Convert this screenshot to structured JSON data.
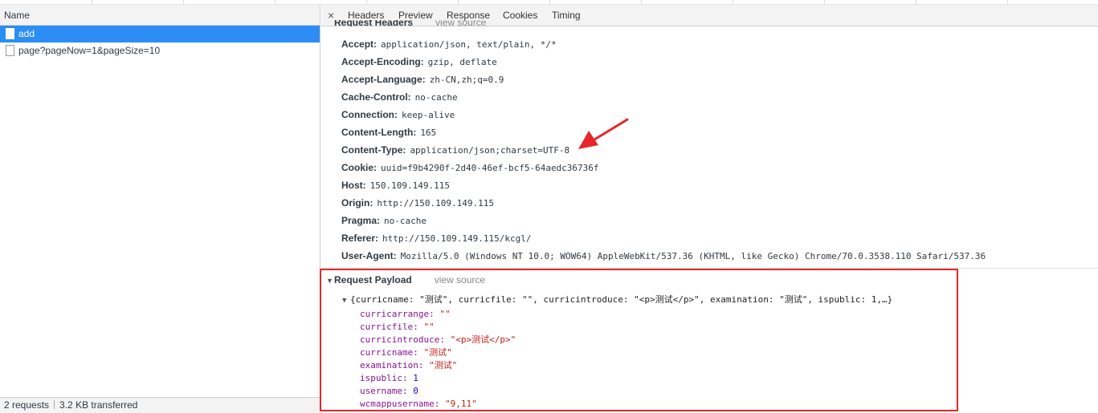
{
  "network": {
    "name_column_label": "Name",
    "requests": [
      {
        "name": "add",
        "selected": true
      },
      {
        "name": "page?pageNow=1&pageSize=10",
        "selected": false
      }
    ],
    "status": {
      "requests": "2 requests",
      "transferred": "3.2 KB transferred"
    }
  },
  "details": {
    "close_symbol": "×",
    "tabs": [
      "Headers",
      "Preview",
      "Response",
      "Cookies",
      "Timing"
    ],
    "request_headers_title": "Request Headers",
    "view_source_label": "view source",
    "headers": [
      {
        "key": "Accept:",
        "value": "application/json, text/plain, */*"
      },
      {
        "key": "Accept-Encoding:",
        "value": "gzip, deflate"
      },
      {
        "key": "Accept-Language:",
        "value": "zh-CN,zh;q=0.9"
      },
      {
        "key": "Cache-Control:",
        "value": "no-cache"
      },
      {
        "key": "Connection:",
        "value": "keep-alive"
      },
      {
        "key": "Content-Length:",
        "value": "165"
      },
      {
        "key": "Content-Type:",
        "value": "application/json;charset=UTF-8"
      },
      {
        "key": "Cookie:",
        "value": "uuid=f9b4290f-2d40-46ef-bcf5-64aedc36736f"
      },
      {
        "key": "Host:",
        "value": "150.109.149.115"
      },
      {
        "key": "Origin:",
        "value": "http://150.109.149.115"
      },
      {
        "key": "Pragma:",
        "value": "no-cache"
      },
      {
        "key": "Referer:",
        "value": "http://150.109.149.115/kcgl/"
      },
      {
        "key": "User-Agent:",
        "value": "Mozilla/5.0 (Windows NT 10.0; WOW64) AppleWebKit/537.36 (KHTML, like Gecko) Chrome/70.0.3538.110 Safari/537.36"
      }
    ],
    "payload": {
      "title": "Request Payload",
      "view_source_label": "view source",
      "summary": "{curricname: \"测试\", curricfile: \"\", curricintroduce: \"<p>测试</p>\", examination: \"测试\", ispublic: 1,…}",
      "fields": [
        {
          "key": "curricarrange:",
          "value": "\"\"",
          "type": "string"
        },
        {
          "key": "curricfile:",
          "value": "\"\"",
          "type": "string"
        },
        {
          "key": "curricintroduce:",
          "value": "\"<p>测试</p>\"",
          "type": "string"
        },
        {
          "key": "curricname:",
          "value": "\"测试\"",
          "type": "string"
        },
        {
          "key": "examination:",
          "value": "\"测试\"",
          "type": "string"
        },
        {
          "key": "ispublic:",
          "value": "1",
          "type": "number"
        },
        {
          "key": "username:",
          "value": "0",
          "type": "number"
        },
        {
          "key": "wcmappusername:",
          "value": "\"9,11\"",
          "type": "string"
        }
      ]
    }
  },
  "annotation": {
    "highlight_color": "#e8262a",
    "arrow_color": "#e8262a"
  },
  "colors": {
    "selection": "#2c8ef4",
    "key_purple": "#881391",
    "string_red": "#c41a16",
    "number_blue": "#1c00cf"
  }
}
